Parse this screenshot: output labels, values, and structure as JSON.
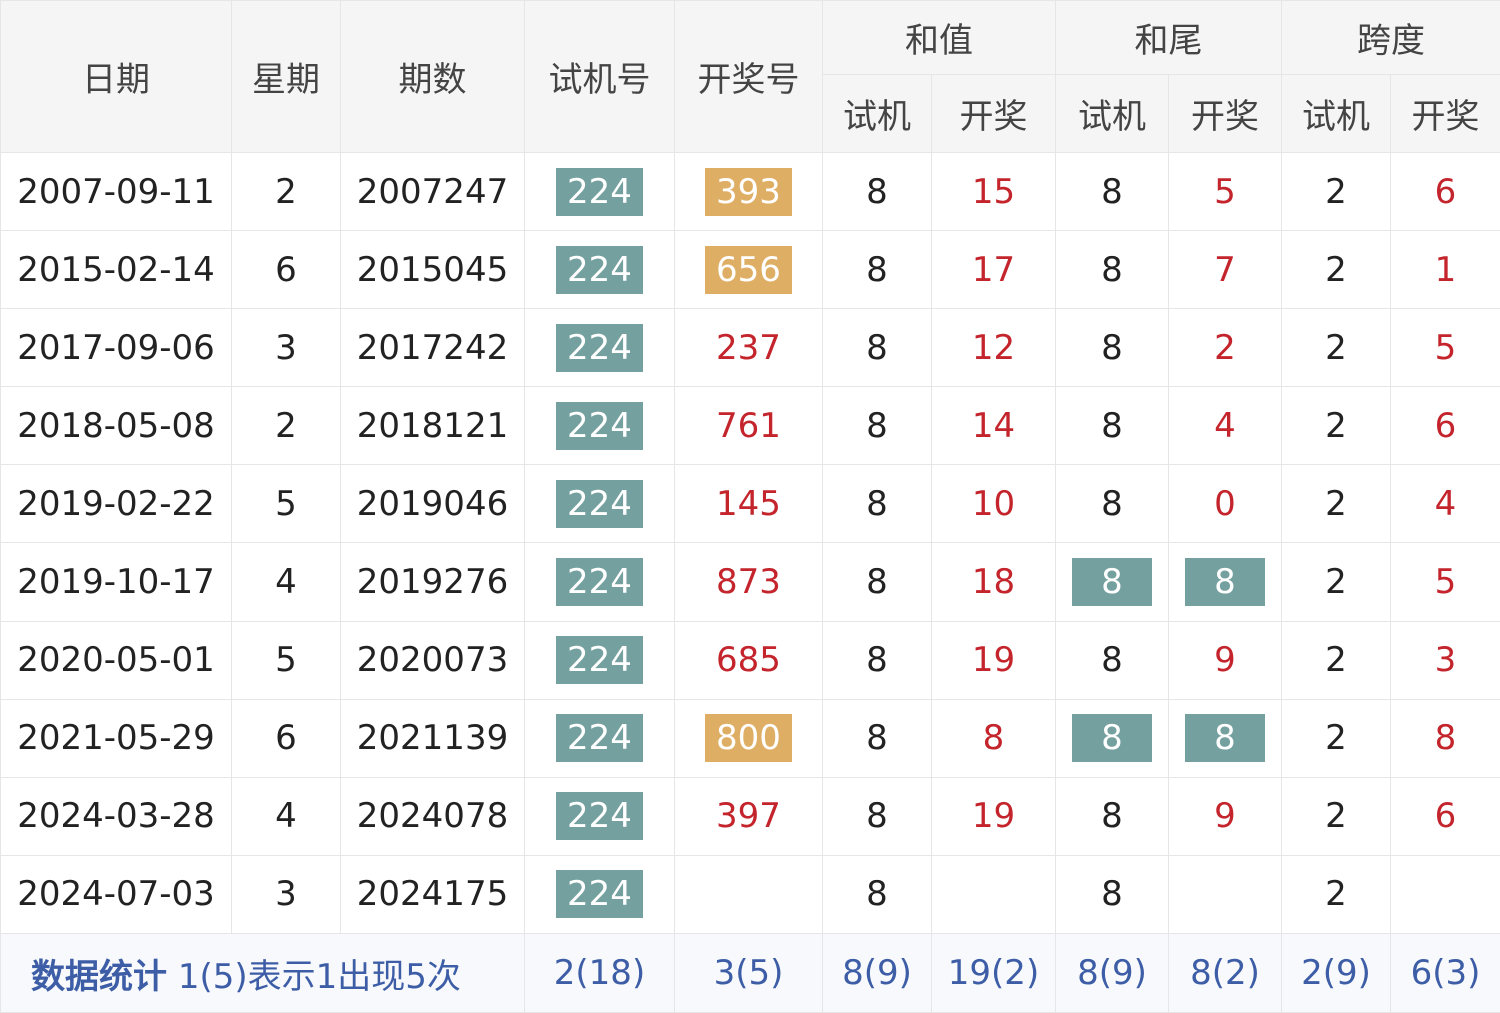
{
  "headers": {
    "date": "日期",
    "weekday": "星期",
    "issue": "期数",
    "trial": "试机号",
    "draw": "开奖号",
    "sum": "和值",
    "tail": "和尾",
    "span": "跨度",
    "sub_trial": "试机",
    "sub_draw": "开奖"
  },
  "rows": [
    {
      "date": "2007-09-11",
      "weekday": "2",
      "issue": "2007247",
      "trial": "224",
      "draw": "393",
      "draw_highlight": true,
      "sum_trial": "8",
      "sum_draw": "15",
      "tail_trial": "8",
      "tail_draw": "5",
      "tail_highlight": false,
      "span_trial": "2",
      "span_draw": "6"
    },
    {
      "date": "2015-02-14",
      "weekday": "6",
      "issue": "2015045",
      "trial": "224",
      "draw": "656",
      "draw_highlight": true,
      "sum_trial": "8",
      "sum_draw": "17",
      "tail_trial": "8",
      "tail_draw": "7",
      "tail_highlight": false,
      "span_trial": "2",
      "span_draw": "1"
    },
    {
      "date": "2017-09-06",
      "weekday": "3",
      "issue": "2017242",
      "trial": "224",
      "draw": "237",
      "draw_highlight": false,
      "sum_trial": "8",
      "sum_draw": "12",
      "tail_trial": "8",
      "tail_draw": "2",
      "tail_highlight": false,
      "span_trial": "2",
      "span_draw": "5"
    },
    {
      "date": "2018-05-08",
      "weekday": "2",
      "issue": "2018121",
      "trial": "224",
      "draw": "761",
      "draw_highlight": false,
      "sum_trial": "8",
      "sum_draw": "14",
      "tail_trial": "8",
      "tail_draw": "4",
      "tail_highlight": false,
      "span_trial": "2",
      "span_draw": "6"
    },
    {
      "date": "2019-02-22",
      "weekday": "5",
      "issue": "2019046",
      "trial": "224",
      "draw": "145",
      "draw_highlight": false,
      "sum_trial": "8",
      "sum_draw": "10",
      "tail_trial": "8",
      "tail_draw": "0",
      "tail_highlight": false,
      "span_trial": "2",
      "span_draw": "4"
    },
    {
      "date": "2019-10-17",
      "weekday": "4",
      "issue": "2019276",
      "trial": "224",
      "draw": "873",
      "draw_highlight": false,
      "sum_trial": "8",
      "sum_draw": "18",
      "tail_trial": "8",
      "tail_draw": "8",
      "tail_highlight": true,
      "span_trial": "2",
      "span_draw": "5"
    },
    {
      "date": "2020-05-01",
      "weekday": "5",
      "issue": "2020073",
      "trial": "224",
      "draw": "685",
      "draw_highlight": false,
      "sum_trial": "8",
      "sum_draw": "19",
      "tail_trial": "8",
      "tail_draw": "9",
      "tail_highlight": false,
      "span_trial": "2",
      "span_draw": "3"
    },
    {
      "date": "2021-05-29",
      "weekday": "6",
      "issue": "2021139",
      "trial": "224",
      "draw": "800",
      "draw_highlight": true,
      "sum_trial": "8",
      "sum_draw": "8",
      "tail_trial": "8",
      "tail_draw": "8",
      "tail_highlight": true,
      "span_trial": "2",
      "span_draw": "8"
    },
    {
      "date": "2024-03-28",
      "weekday": "4",
      "issue": "2024078",
      "trial": "224",
      "draw": "397",
      "draw_highlight": false,
      "sum_trial": "8",
      "sum_draw": "19",
      "tail_trial": "8",
      "tail_draw": "9",
      "tail_highlight": false,
      "span_trial": "2",
      "span_draw": "6"
    },
    {
      "date": "2024-07-03",
      "weekday": "3",
      "issue": "2024175",
      "trial": "224",
      "draw": "",
      "draw_highlight": false,
      "sum_trial": "8",
      "sum_draw": "",
      "tail_trial": "8",
      "tail_draw": "",
      "tail_highlight": false,
      "span_trial": "2",
      "span_draw": ""
    }
  ],
  "stats": {
    "title": "数据统计",
    "note": "1(5)表示1出现5次",
    "trial": "2(18)",
    "draw": "3(5)",
    "sum_trial": "8(9)",
    "sum_draw": "19(2)",
    "tail_trial": "8(9)",
    "tail_draw": "8(2)",
    "span_trial": "2(9)",
    "span_draw": "6(3)"
  },
  "colors": {
    "trial_badge": "#74a1a0",
    "draw_badge": "#dfae65",
    "tail_match_badge": "#74a1a0",
    "draw_text": "#c4242b",
    "stats_text": "#3d5da6"
  }
}
